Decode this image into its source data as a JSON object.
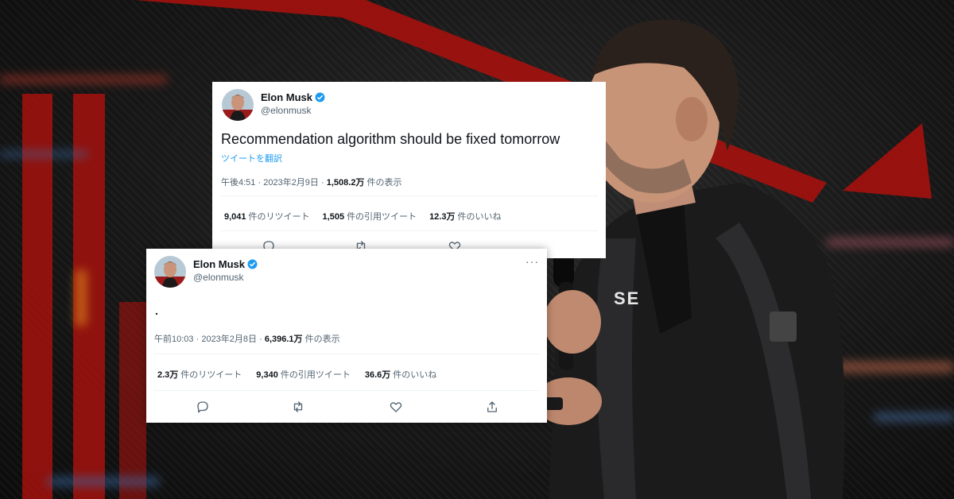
{
  "tweets": [
    {
      "author_name": "Elon Musk",
      "author_handle": "@elonmusk",
      "text": "Recommendation algorithm should be fixed tomorrow",
      "translate_label": "ツイートを翻訳",
      "time": "午後4:51",
      "date": "2023年2月9日",
      "views_count": "1,508.2万",
      "views_label": "件の表示",
      "retweets_count": "9,041",
      "retweets_label": "件のリツイート",
      "quotes_count": "1,505",
      "quotes_label": "件の引用ツイート",
      "likes_count": "12.3万",
      "likes_label": "件のいいね"
    },
    {
      "author_name": "Elon Musk",
      "author_handle": "@elonmusk",
      "text": ".",
      "more_label": "···",
      "time": "午前10:03",
      "date": "2023年2月8日",
      "views_count": "6,396.1万",
      "views_label": "件の表示",
      "retweets_count": "2.3万",
      "retweets_label": "件のリツイート",
      "quotes_count": "9,340",
      "quotes_label": "件の引用ツイート",
      "likes_count": "36.6万",
      "likes_label": "件のいいね"
    }
  ],
  "separator": "·",
  "colors": {
    "accent_blue": "#1d9bf0",
    "background_red": "#a5120d",
    "text_primary": "#0f1419",
    "text_secondary": "#536471"
  },
  "icons": [
    "verified-badge-icon",
    "reply-icon",
    "retweet-icon",
    "like-icon",
    "share-icon",
    "more-icon"
  ]
}
